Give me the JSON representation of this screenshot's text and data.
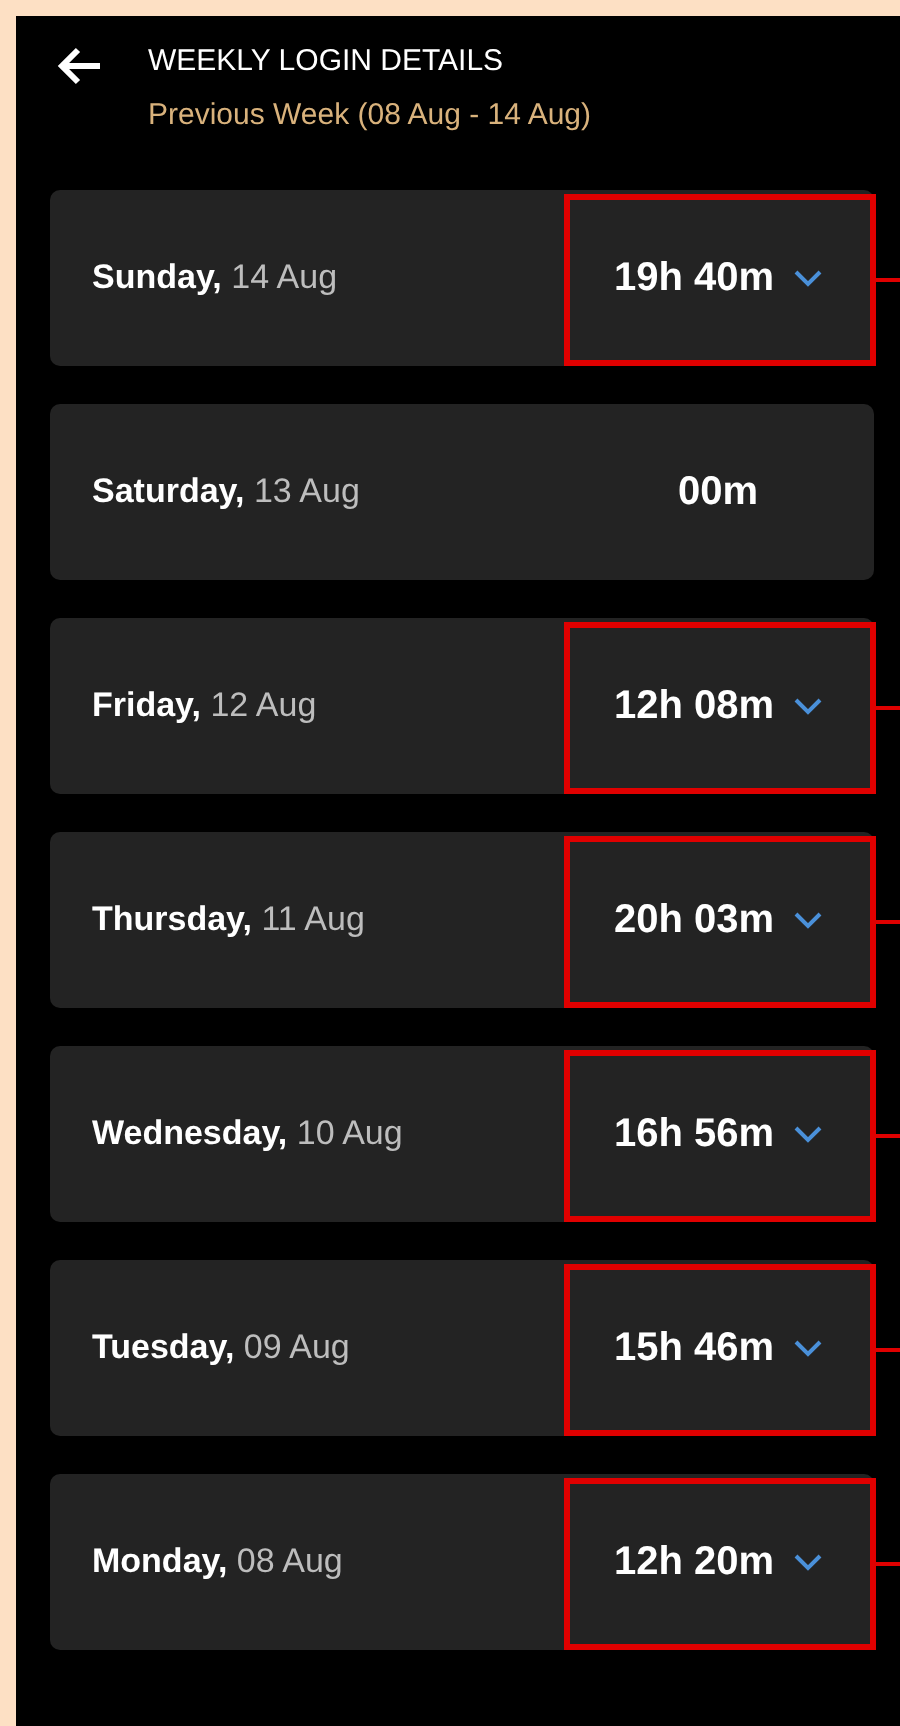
{
  "header": {
    "title": "WEEKLY LOGIN DETAILS",
    "subtitle": "Previous Week (08 Aug - 14 Aug)"
  },
  "days": [
    {
      "weekday": "Sunday,",
      "date": "14 Aug",
      "duration": "19h 40m",
      "expandable": true,
      "annotated": true
    },
    {
      "weekday": "Saturday,",
      "date": "13 Aug",
      "duration": "00m",
      "expandable": false,
      "annotated": false
    },
    {
      "weekday": "Friday,",
      "date": "12 Aug",
      "duration": "12h 08m",
      "expandable": true,
      "annotated": true
    },
    {
      "weekday": "Thursday,",
      "date": "11 Aug",
      "duration": "20h 03m",
      "expandable": true,
      "annotated": true
    },
    {
      "weekday": "Wednesday,",
      "date": "10 Aug",
      "duration": "16h 56m",
      "expandable": true,
      "annotated": true
    },
    {
      "weekday": "Tuesday,",
      "date": "09 Aug",
      "duration": "15h 46m",
      "expandable": true,
      "annotated": true
    },
    {
      "weekday": "Monday,",
      "date": "08 Aug",
      "duration": "12h 20m",
      "expandable": true,
      "annotated": true
    }
  ]
}
